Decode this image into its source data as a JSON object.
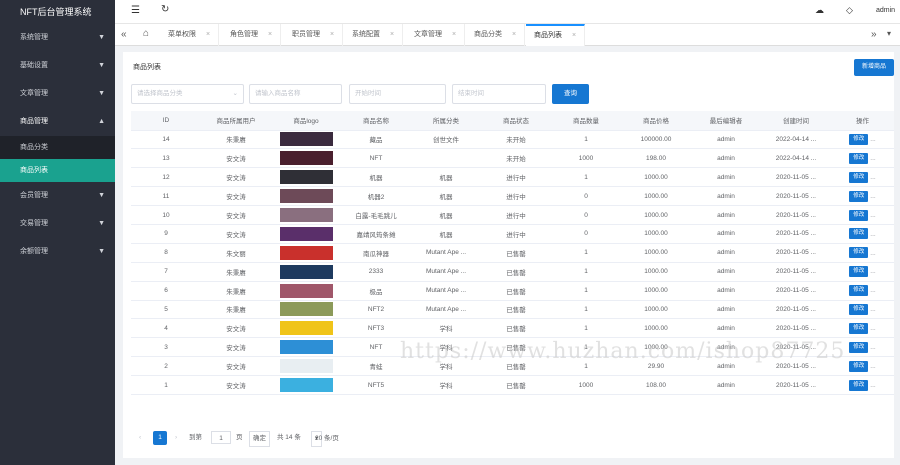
{
  "app": {
    "title": "NFT后台管理系统"
  },
  "sidebar": {
    "groups": [
      {
        "label": "系统管理"
      },
      {
        "label": "基础设置"
      },
      {
        "label": "文章管理"
      },
      {
        "label": "商品管理",
        "children": [
          {
            "label": "商品分类"
          },
          {
            "label": "商品列表"
          }
        ]
      },
      {
        "label": "会员管理"
      },
      {
        "label": "交易管理"
      },
      {
        "label": "余额管理"
      }
    ]
  },
  "topbar": {
    "user": "admin"
  },
  "tabs": [
    "菜单权限",
    "角色管理",
    "职员管理",
    "系统配置",
    "文章管理",
    "商品分类",
    "商品列表"
  ],
  "page": {
    "title": "商品列表",
    "add_button": "新增商品",
    "filters": {
      "category_placeholder": "请选择商品分类",
      "name_placeholder": "请输入商品名称",
      "start_placeholder": "开始时间",
      "end_placeholder": "结束时间",
      "query_button": "查询"
    }
  },
  "table": {
    "headers": [
      "ID",
      "商品所属用户",
      "商品logo",
      "商品名称",
      "所属分类",
      "商品状态",
      "商品数量",
      "商品价格",
      "最后编辑者",
      "创建时间",
      "操作"
    ],
    "edit_label": "修改",
    "more_label": "...",
    "rows": [
      {
        "id": "14",
        "owner": "朱秉赓",
        "name": "藏品",
        "category": "创世文件",
        "status": "未开始",
        "qty": "1",
        "price": "100000.00",
        "editor": "admin",
        "created": "2022-04-14 ...",
        "thumb": "#3a2a3e"
      },
      {
        "id": "13",
        "owner": "安文涛",
        "name": "NFT",
        "category": "",
        "status": "未开始",
        "qty": "1000",
        "price": "198.00",
        "editor": "admin",
        "created": "2022-04-14 ...",
        "thumb": "#4a1f2e"
      },
      {
        "id": "12",
        "owner": "安文涛",
        "name": "机器",
        "category": "机器",
        "status": "进行中",
        "qty": "1",
        "price": "1000.00",
        "editor": "admin",
        "created": "2020-11-05 ...",
        "thumb": "#2f2f36"
      },
      {
        "id": "11",
        "owner": "安文涛",
        "name": "机器2",
        "category": "机器",
        "status": "进行中",
        "qty": "0",
        "price": "1000.00",
        "editor": "admin",
        "created": "2020-11-05 ...",
        "thumb": "#6d4a58"
      },
      {
        "id": "10",
        "owner": "安文涛",
        "name": "白露-毛毛跳儿",
        "category": "机器",
        "status": "进行中",
        "qty": "0",
        "price": "1000.00",
        "editor": "admin",
        "created": "2020-11-05 ...",
        "thumb": "#8a6f7f"
      },
      {
        "id": "9",
        "owner": "安文涛",
        "name": "嘉靖风筠条摊",
        "category": "机器",
        "status": "进行中",
        "qty": "0",
        "price": "1000.00",
        "editor": "admin",
        "created": "2020-11-05 ...",
        "thumb": "#5a2f6a"
      },
      {
        "id": "8",
        "owner": "朱文丽",
        "name": "南瓜神器",
        "category": "Mutant Ape ...",
        "status": "已售罄",
        "qty": "1",
        "price": "1000.00",
        "editor": "admin",
        "created": "2020-11-05 ...",
        "thumb": "#c9302c"
      },
      {
        "id": "7",
        "owner": "朱秉赓",
        "name": "2333",
        "category": "Mutant Ape ...",
        "status": "已售罄",
        "qty": "1",
        "price": "1000.00",
        "editor": "admin",
        "created": "2020-11-05 ...",
        "thumb": "#1e3a5f"
      },
      {
        "id": "6",
        "owner": "朱秉赓",
        "name": "极品",
        "category": "Mutant Ape ...",
        "status": "已售罄",
        "qty": "1",
        "price": "1000.00",
        "editor": "admin",
        "created": "2020-11-05 ...",
        "thumb": "#a0576a"
      },
      {
        "id": "5",
        "owner": "朱秉赓",
        "name": "NFT2",
        "category": "Mutant Ape ...",
        "status": "已售罄",
        "qty": "1",
        "price": "1000.00",
        "editor": "admin",
        "created": "2020-11-05 ...",
        "thumb": "#8c9a5a"
      },
      {
        "id": "4",
        "owner": "安文涛",
        "name": "NFT3",
        "category": "学科",
        "status": "已售罄",
        "qty": "1",
        "price": "1000.00",
        "editor": "admin",
        "created": "2020-11-05 ...",
        "thumb": "#f0c419"
      },
      {
        "id": "3",
        "owner": "安文涛",
        "name": "NFT",
        "category": "学科",
        "status": "已售罄",
        "qty": "1",
        "price": "1000.00",
        "editor": "admin",
        "created": "2020-11-05 ...",
        "thumb": "#2d8fd6"
      },
      {
        "id": "2",
        "owner": "安文涛",
        "name": "青蛙",
        "category": "学科",
        "status": "已售罄",
        "qty": "1",
        "price": "29.90",
        "editor": "admin",
        "created": "2020-11-05 ...",
        "thumb": "#e8eef2"
      },
      {
        "id": "1",
        "owner": "安文涛",
        "name": "NFT5",
        "category": "学科",
        "status": "已售罄",
        "qty": "1000",
        "price": "108.00",
        "editor": "admin",
        "created": "2020-11-05 ...",
        "thumb": "#3bb0e0"
      }
    ]
  },
  "pager": {
    "current": "1",
    "goto_label": "到第",
    "goto_value": "1",
    "page_unit": "页",
    "confirm": "确定",
    "total": "共 14 条",
    "page_size": "20 条/页"
  },
  "watermark": "https://www.huzhan.com/ishop87725",
  "colors": {
    "sidebar": "#2b2f3a",
    "active": "#1aa28f",
    "primary": "#1677d2"
  }
}
